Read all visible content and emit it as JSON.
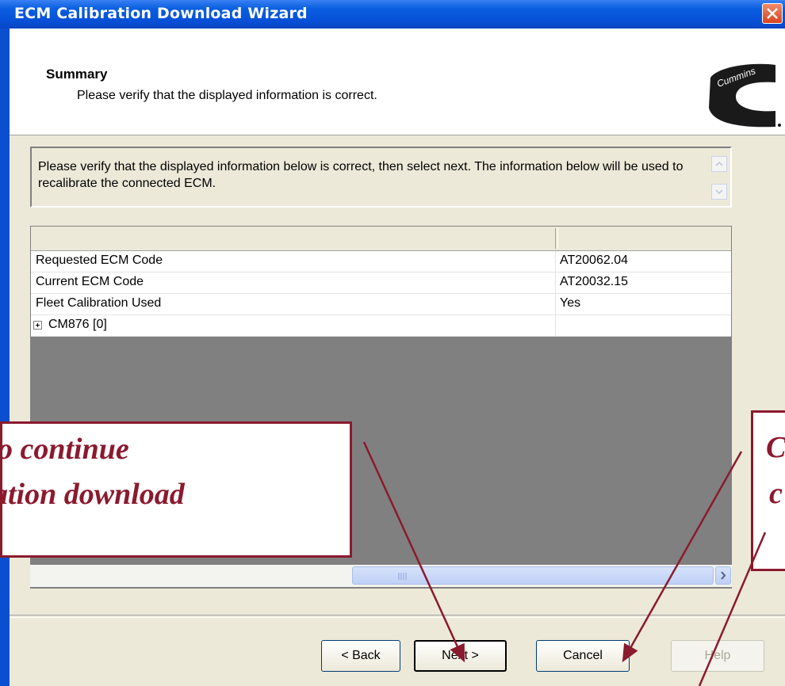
{
  "window": {
    "title": "ECM Calibration Download Wizard",
    "close_icon": "close-icon"
  },
  "header": {
    "title": "Summary",
    "subtitle": "Please verify that the displayed information is correct.",
    "logo_text": "Cummins"
  },
  "info": {
    "text": "Please verify that the displayed information below is correct, then select next. The information below will be used to recalibrate the connected ECM."
  },
  "grid": {
    "columns": [
      "",
      ""
    ],
    "rows": [
      {
        "label": "Requested ECM Code",
        "value": "AT20062.04"
      },
      {
        "label": "Current ECM Code",
        "value": "AT20032.15"
      },
      {
        "label": "Fleet Calibration Used",
        "value": "Yes"
      },
      {
        "label": "CM876 [0]",
        "value": "",
        "expandable": true
      }
    ]
  },
  "buttons": {
    "back": "< Back",
    "next": "Next >",
    "cancel": "Cancel",
    "help": "Help"
  },
  "callouts": {
    "left": {
      "line1": "o continue",
      "line2": "ation download"
    },
    "right": {
      "line1": "C",
      "line2": "c"
    }
  },
  "colors": {
    "titlebar": "#0751d8",
    "callout": "#8b1a2e",
    "grid_empty": "#808080"
  }
}
